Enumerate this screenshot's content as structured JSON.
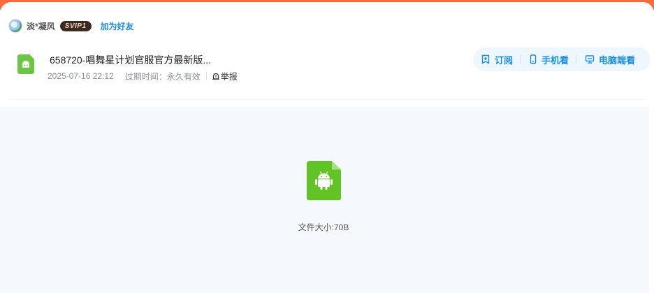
{
  "user": {
    "name": "淡*凝风",
    "badge": "SVIP1",
    "add_friend_label": "加为好友"
  },
  "file": {
    "title": "658720-唱舞星计划官服官方最新版...",
    "date": "2025-07-16 22:12",
    "expire_label": "过期时间：永久有效",
    "report_label": "举报",
    "icon": "android-apk-icon",
    "size_label": "文件大小:70B"
  },
  "actions": [
    {
      "label": "订阅",
      "icon": "subscribe-icon"
    },
    {
      "label": "手机看",
      "icon": "phone-icon"
    },
    {
      "label": "电脑端看",
      "icon": "monitor-icon"
    }
  ],
  "colors": {
    "accent": "#1a8ce6",
    "top_band": "#ff6a3c",
    "android_green": "#61c325",
    "preview_bg": "#f5f8fc"
  }
}
